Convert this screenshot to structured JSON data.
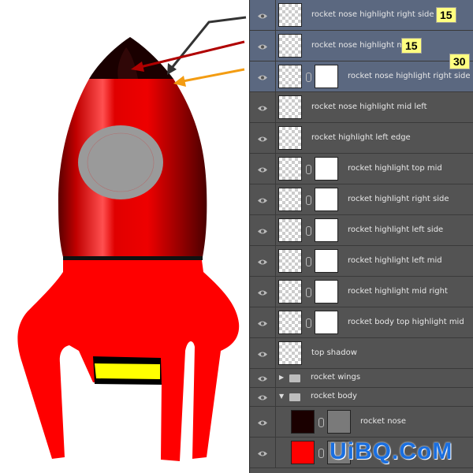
{
  "layers": [
    {
      "name": "rocket nose highlight right side up",
      "selected": true,
      "mask": false,
      "badge": "15"
    },
    {
      "name": "rocket nose highlight mid",
      "selected": true,
      "mask": false,
      "badge": "15"
    },
    {
      "name": "rocket nose highlight right side dn",
      "selected": true,
      "mask": true,
      "badge": "30"
    },
    {
      "name": "rocket nose highlight mid left",
      "selected": false,
      "mask": false
    },
    {
      "name": "rocket highlight left edge",
      "selected": false,
      "mask": false
    },
    {
      "name": "rocket highlight top mid",
      "selected": false,
      "mask": true
    },
    {
      "name": "rocket highlight right side",
      "selected": false,
      "mask": true
    },
    {
      "name": "rocket highlight left side",
      "selected": false,
      "mask": true
    },
    {
      "name": "rocket highlight left mid",
      "selected": false,
      "mask": true
    },
    {
      "name": "rocket highlight mid right",
      "selected": false,
      "mask": true
    },
    {
      "name": "rocket body top highlight mid",
      "selected": false,
      "mask": true
    },
    {
      "name": "top shadow",
      "selected": false,
      "mask": false
    }
  ],
  "groups": [
    {
      "name": "rocket wings",
      "expanded": false
    },
    {
      "name": "rocket body",
      "expanded": true
    }
  ],
  "fill_layers": [
    {
      "name": "rocket nose",
      "color": "#1a0000"
    },
    {
      "name": "",
      "color": "#ff0000"
    }
  ],
  "watermark": "UiBQ.CoM",
  "colors": {
    "panel": "#535353",
    "selected": "#5b6880",
    "badge": "#ffff80",
    "rocket": "#ff0000",
    "arrow_dark": "#333333",
    "arrow_red": "#b00000",
    "arrow_orange": "#f39c12"
  }
}
